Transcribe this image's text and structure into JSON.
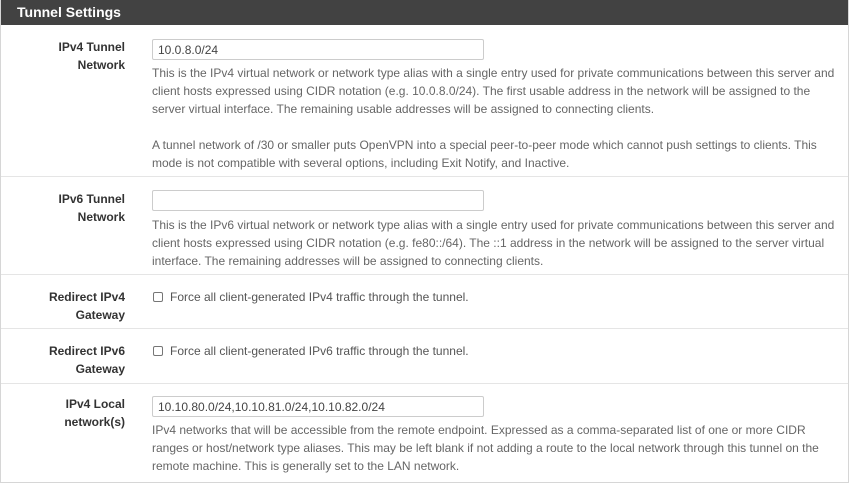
{
  "panel": {
    "title": "Tunnel Settings"
  },
  "ipv4_tunnel": {
    "label_line1": "IPv4 Tunnel",
    "label_line2": "Network",
    "value": "10.0.8.0/24",
    "help_p1": "This is the IPv4 virtual network or network type alias with a single entry used for private communications between this server and client hosts expressed using CIDR notation (e.g. 10.0.8.0/24). The first usable address in the network will be assigned to the server virtual interface. The remaining usable addresses will be assigned to connecting clients.",
    "help_p2": "A tunnel network of /30 or smaller puts OpenVPN into a special peer-to-peer mode which cannot push settings to clients. This mode is not compatible with several options, including Exit Notify, and Inactive."
  },
  "ipv6_tunnel": {
    "label_line1": "IPv6 Tunnel",
    "label_line2": "Network",
    "value": "",
    "help": "This is the IPv6 virtual network or network type alias with a single entry used for private communications between this server and client hosts expressed using CIDR notation (e.g. fe80::/64). The ::1 address in the network will be assigned to the server virtual interface. The remaining addresses will be assigned to connecting clients."
  },
  "redirect_ipv4": {
    "label_line1": "Redirect IPv4",
    "label_line2": "Gateway",
    "checkbox_label": "Force all client-generated IPv4 traffic through the tunnel.",
    "checked": false
  },
  "redirect_ipv6": {
    "label_line1": "Redirect IPv6",
    "label_line2": "Gateway",
    "checkbox_label": "Force all client-generated IPv6 traffic through the tunnel.",
    "checked": false
  },
  "ipv4_local": {
    "label_line1": "IPv4 Local",
    "label_line2": "network(s)",
    "value": "10.10.80.0/24,10.10.81.0/24,10.10.82.0/24",
    "help": "IPv4 networks that will be accessible from the remote endpoint. Expressed as a comma-separated list of one or more CIDR ranges or host/network type aliases. This may be left blank if not adding a route to the local network through this tunnel on the remote machine. This is generally set to the LAN network."
  }
}
